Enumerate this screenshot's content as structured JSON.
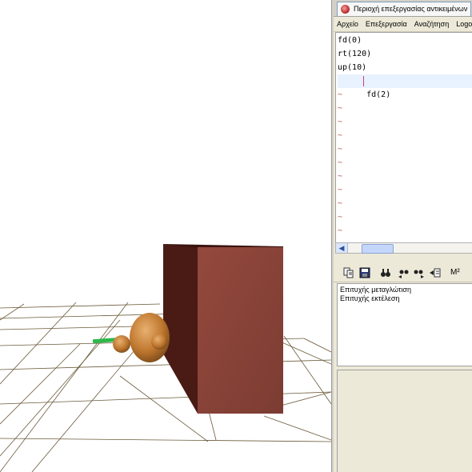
{
  "panel": {
    "tab_title": "Περιοχή επεξεργασίας αντικειμένων"
  },
  "menu": {
    "items": [
      "Αρχείο",
      "Επεξεργασία",
      "Αναζήτηση",
      "Logo"
    ]
  },
  "editor": {
    "lines": [
      "fd(0)",
      "rt(120)",
      "up(10)",
      "fd(2)"
    ],
    "empty_marker": "~",
    "current_line_index": 3
  },
  "toolbar": {
    "icons": [
      "copy-icon",
      "save-icon",
      "find-icon",
      "find-prev-icon",
      "find-next-icon",
      "insert-icon",
      "macro-icon"
    ],
    "macro_label": "M²"
  },
  "messages": {
    "lines": [
      "Επιτυχής μεταγλώτιση",
      "Επιτυχής εκτέλεση"
    ]
  },
  "colors": {
    "box_front": "#8a4438",
    "box_side": "#4a1a14",
    "turtle": "#c07830",
    "pen": "#2db84a",
    "grid": "#6b5a3a"
  }
}
